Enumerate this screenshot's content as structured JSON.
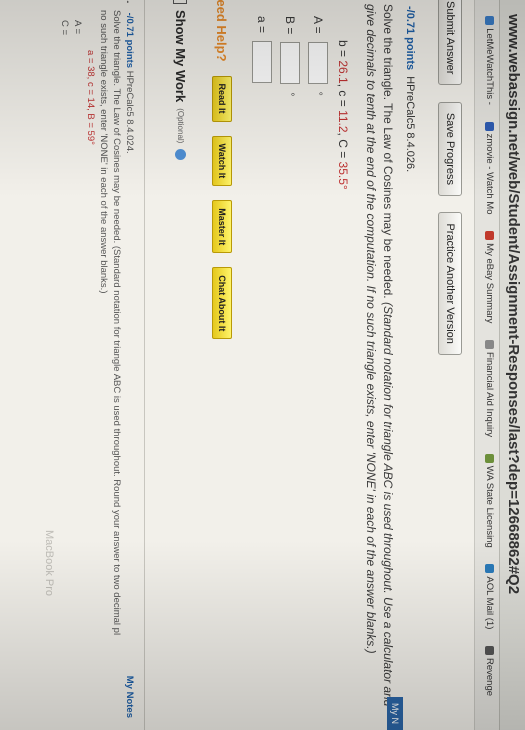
{
  "browser": {
    "url": "www.webassign.net/web/Student/Assignment-Responses/last?dep=12668862#Q2",
    "bookmarks": [
      {
        "label": "LetMeWatchThis - ",
        "color": "#3a7cc5"
      },
      {
        "label": "zmovie - Watch Mo",
        "color": "#2e5cb3"
      },
      {
        "label": "My eBay Summary",
        "color": "#c0392b"
      },
      {
        "label": "Financial Aid Inquiry",
        "color": "#888888"
      },
      {
        "label": "WA State Licensing",
        "color": "#6c8f3a"
      },
      {
        "label": "AOL Mail (1)",
        "color": "#2a7ab8"
      },
      {
        "label": "Revenge",
        "color": "#555555"
      }
    ],
    "bookmark_prefix": "etflix"
  },
  "toolbar": {
    "submit_label": "Submit Answer",
    "save_label": "Save Progress",
    "practice_label": "Practice Another Version"
  },
  "question": {
    "points": "-/0.71 points",
    "code": "HPreCalc5 8.4.026.",
    "instruction_main": "Solve the triangle. The Law of Cosines may be needed.",
    "instruction_italic": "(Standard notation for triangle ABC is used throughout. Use a calculator and give decimals to tenth at the end of the computation. If no such triangle exists, enter 'NONE' in each of the answer blanks.)",
    "given_b": "26.1",
    "given_c": "11.2",
    "given_C": "35.5°",
    "answers": [
      {
        "label": "A =",
        "unit": "°"
      },
      {
        "label": "B =",
        "unit": "°"
      },
      {
        "label": "a =",
        "unit": ""
      }
    ]
  },
  "help": {
    "label": "Need Help?",
    "buttons": [
      "Read It",
      "Watch It",
      "Master It",
      "Chat About It"
    ]
  },
  "show_work": {
    "label": "Show My Work",
    "optional": "(Optional)"
  },
  "my_notes": "My N",
  "next_question": {
    "number": "12.",
    "points": "-/0.71 points",
    "code": "HPreCalc5 8.4.024.",
    "text": "Solve the triangle. The Law of Cosines may be needed. (Standard notation for triangle ABC is used throughout. Round your answer to two decimal pl",
    "text2": "no such triangle exists, enter 'NONE' in each of the answer blanks.)",
    "given": "a = 38, c = 14, B = 59°",
    "answer_labels": [
      "A =",
      "C ="
    ],
    "notes": "My Notes"
  },
  "watermark": "MacBook Pro"
}
